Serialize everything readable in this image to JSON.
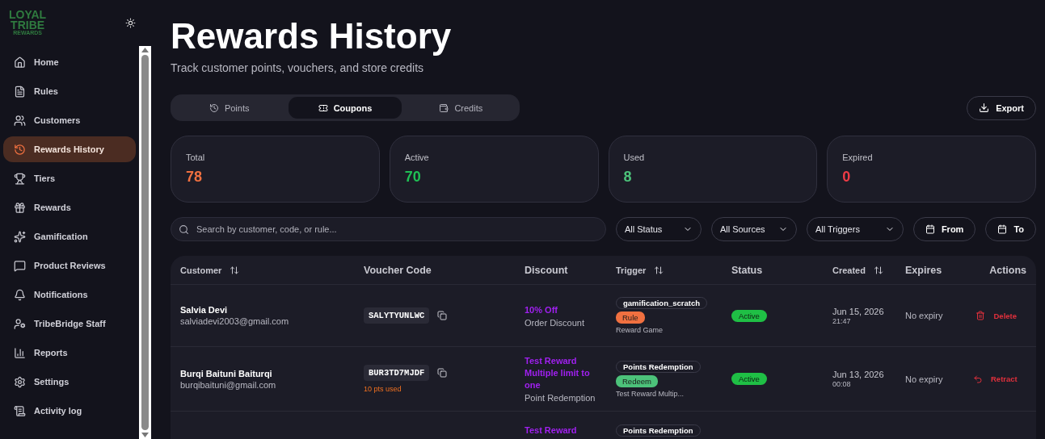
{
  "logo": {
    "lines": [
      "LOYAL",
      "TRIBE",
      "REWARDS"
    ]
  },
  "sidebar": {
    "items": [
      {
        "label": "Home",
        "selected": false
      },
      {
        "label": "Rules",
        "selected": false
      },
      {
        "label": "Customers",
        "selected": false
      },
      {
        "label": "Rewards History",
        "selected": true
      },
      {
        "label": "Tiers",
        "selected": false
      },
      {
        "label": "Rewards",
        "selected": false
      },
      {
        "label": "Gamification",
        "selected": false
      },
      {
        "label": "Product Reviews",
        "selected": false
      },
      {
        "label": "Notifications",
        "selected": false
      },
      {
        "label": "TribeBridge Staff",
        "selected": false
      },
      {
        "label": "Reports",
        "selected": false
      },
      {
        "label": "Settings",
        "selected": false
      },
      {
        "label": "Activity log",
        "selected": false
      }
    ]
  },
  "header": {
    "title": "Rewards History",
    "subtitle": "Track customer points, vouchers, and store credits"
  },
  "tabs": [
    {
      "label": "Points",
      "selected": false
    },
    {
      "label": "Coupons",
      "selected": true
    },
    {
      "label": "Credits",
      "selected": false
    }
  ],
  "export_button": "Export",
  "stats": [
    {
      "label": "Total",
      "value": "78",
      "color": "#f07040"
    },
    {
      "label": "Active",
      "value": "70",
      "color": "#1fbf55"
    },
    {
      "label": "Used",
      "value": "8",
      "color": "#4cc27a"
    },
    {
      "label": "Expired",
      "value": "0",
      "color": "#ef3b46"
    }
  ],
  "search": {
    "placeholder": "Search by customer, code, or rule..."
  },
  "filters": [
    "All Status",
    "All Sources",
    "All Triggers"
  ],
  "date_buttons": [
    "From",
    "To"
  ],
  "table": {
    "columns": [
      {
        "label": "Customer",
        "sortable": true
      },
      {
        "label": "Voucher Code",
        "sortable": false
      },
      {
        "label": "Discount",
        "sortable": false
      },
      {
        "label": "Trigger",
        "sortable": true
      },
      {
        "label": "Status",
        "sortable": false
      },
      {
        "label": "Created",
        "sortable": true
      },
      {
        "label": "Expires",
        "sortable": false
      },
      {
        "label": "Actions",
        "sortable": false
      }
    ],
    "rows": [
      {
        "name": "Salvia Devi",
        "email": "salviadevi2003@gmail.com",
        "code": "SALYTYUNLWC",
        "discount_title": "10% Off",
        "discount_type": "Order Discount",
        "trigger": "gamification_scratch",
        "tag": {
          "kind": "rule",
          "label": "Rule"
        },
        "trigger_note": "Reward Game",
        "status": {
          "kind": "active",
          "label": "Active"
        },
        "date": "Jun 15, 2026",
        "time": "21:47",
        "expires": "No expiry",
        "action": {
          "kind": "delete",
          "label": "Delete"
        }
      },
      {
        "name": "Burqi Baituni Baiturqi",
        "email": "burqibaituni@gmail.com",
        "code": "BUR3TD7MJDF",
        "code_note": "10 pts used",
        "discount_title": "Test Reward Multiple limit to one",
        "discount_type": "Point Redemption",
        "trigger": "Points Redemption",
        "tag": {
          "kind": "redeem",
          "label": "Redeem"
        },
        "trigger_note": "Test Reward Multip...",
        "status": {
          "kind": "active",
          "label": "Active"
        },
        "date": "Jun 13, 2026",
        "time": "00:08",
        "expires": "No expiry",
        "action": {
          "kind": "retract",
          "label": "Retract"
        }
      },
      {
        "discount_title": "Test Reward",
        "trigger": "Points Redemption"
      }
    ]
  }
}
